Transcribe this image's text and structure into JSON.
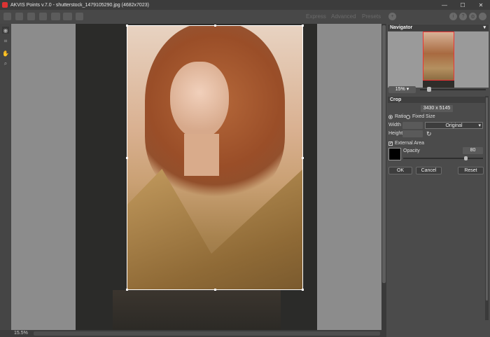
{
  "titlebar": {
    "title": "AKVIS Points v.7.0 - shutterstock_1479105290.jpg (4682x7023)",
    "minimize": "—",
    "maximize": "☐",
    "close": "✕"
  },
  "toolbar": {
    "mode_express": "Express",
    "mode_advanced": "Advanced",
    "presets": "Presets",
    "preset_add_icon": "+",
    "info_icon": "i",
    "help_icon": "?",
    "settings_icon": "⚙"
  },
  "status": {
    "zoom": "15.5%"
  },
  "navigator": {
    "header": "Navigator",
    "menu_icon": "▾",
    "zoom_value": "15% ▾"
  },
  "crop": {
    "header": "Crop",
    "size": "3430 x 5145",
    "ratio_label": "Ratio",
    "fixed_size_label": "Fixed Size",
    "width_label": "Width",
    "height_label": "Height",
    "preset_value": "Original",
    "preset_arrow": "▾",
    "rotate_icon": "↻",
    "external_area_label": "External Area",
    "external_area_checked": "✓",
    "opacity_label": "Opacity",
    "opacity_value": "80",
    "swatch_color": "#000000"
  },
  "buttons": {
    "ok": "OK",
    "cancel": "Cancel",
    "reset": "Reset"
  }
}
